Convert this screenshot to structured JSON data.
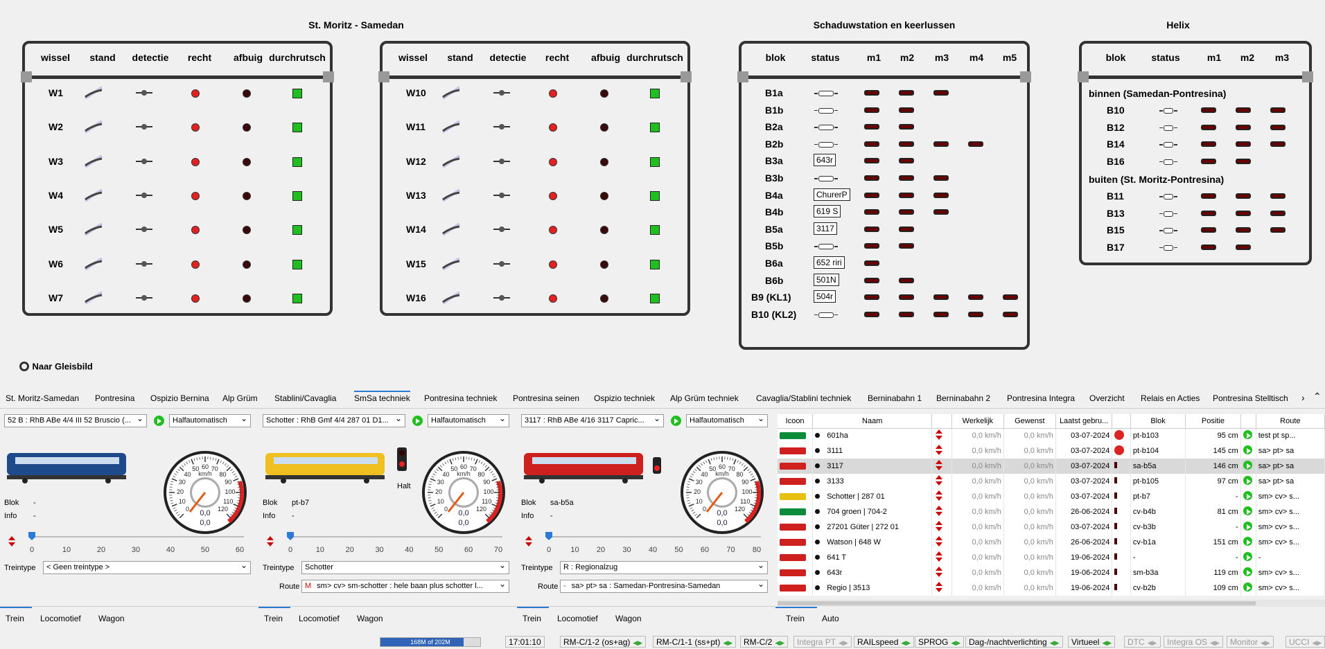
{
  "panels": {
    "stm": {
      "title": "St. Moritz - Samedan",
      "headers": [
        "wissel",
        "stand",
        "detectie",
        "recht",
        "afbuig",
        "durchrutsch"
      ],
      "rows": [
        "W1",
        "W2",
        "W3",
        "W4",
        "W5",
        "W6",
        "W7"
      ]
    },
    "pont": {
      "headers": [
        "wissel",
        "stand",
        "detectie",
        "recht",
        "afbuig",
        "durchrutsch"
      ],
      "rows": [
        "W10",
        "W11",
        "W12",
        "W13",
        "W14",
        "W15",
        "W16"
      ]
    },
    "schad": {
      "title": "Schaduwstation en keerlussen",
      "headers": [
        "blok",
        "status",
        "m1",
        "m2",
        "m3",
        "m4",
        "m5"
      ],
      "rows": [
        "B1a",
        "B1b",
        "B2a",
        "B2b",
        "B3a",
        "B3b",
        "B4a",
        "B4b",
        "B5a",
        "B5b",
        "B6a",
        "B6b",
        "B9 (KL1)",
        "B10 (KL2)"
      ],
      "labels": {
        "B3a": "643r",
        "B4a": "ChurerP",
        "B4b": "619 S",
        "B5a": "3117",
        "B6a": "652 riri",
        "B6b": "501N",
        "B9 (KL1)": "504r"
      }
    },
    "helix": {
      "title": "Helix",
      "headers": [
        "blok",
        "status",
        "m1",
        "m2",
        "m3"
      ],
      "group1": "binnen (Samedan-Pontresina)",
      "rows1": [
        "B10",
        "B12",
        "B14",
        "B16"
      ],
      "group2": "buiten (St. Moritz-Pontresina)",
      "rows2": [
        "B11",
        "B13",
        "B15",
        "B17"
      ]
    }
  },
  "naar_gleisbild": "Naar Gleisbild",
  "tabs": [
    "St. Moritz-Samedan",
    "Pontresina",
    "Ospizio Bernina",
    "Alp Grüm",
    "Stablini/Cavaglia",
    "SmSa techniek",
    "Pontresina techniek",
    "Pontresina seinen",
    "Ospizio techniek",
    "Alp Grüm techniek",
    "Cavaglia/Stablini techniek",
    "Berninabahn 1",
    "Berninabahn 2",
    "Pontresina Integra",
    "Overzicht",
    "Relais en Acties",
    "Pontresina Stelltisch"
  ],
  "throttles": [
    {
      "loco": "52 B : RhB ABe 4/4 III 52 Bruscio (...",
      "mode": "Halfautomatisch",
      "blok_label": "Blok",
      "blok": "-",
      "info_label": "Info",
      "info": "-",
      "speed1": "0,0",
      "speed2": "0,0",
      "unit": "km/h",
      "scale": [
        "0",
        "10",
        "20",
        "30",
        "40",
        "50",
        "60"
      ],
      "gauge": [
        "0",
        "10",
        "20",
        "30",
        "40",
        "50",
        "60",
        "70",
        "80",
        "90",
        "100",
        "110",
        "120"
      ],
      "treintype_label": "Treintype",
      "treintype": "< Geen treintype >",
      "tabs": [
        "Trein",
        "Locomotief",
        "Wagon"
      ]
    },
    {
      "loco": "Schotter : RhB Gmf 4/4 287 01 D1...",
      "mode": "Halfautomatisch",
      "halt": "Halt",
      "blok_label": "Blok",
      "blok": "pt-b7",
      "info_label": "Info",
      "info": "-",
      "speed1": "0,0",
      "speed2": "0,0",
      "unit": "km/h",
      "scale": [
        "0",
        "10",
        "20",
        "30",
        "40",
        "50",
        "60",
        "70"
      ],
      "gauge": [
        "0",
        "10",
        "20",
        "30",
        "40",
        "50",
        "60",
        "70",
        "80",
        "90",
        "100",
        "110",
        "120"
      ],
      "treintype_label": "Treintype",
      "treintype": "Schotter",
      "route_label": "Route",
      "route_prefix": "M",
      "route": "sm> cv> sm-schotter : hele baan plus schotter l...",
      "tabs": [
        "Trein",
        "Locomotief",
        "Wagon"
      ]
    },
    {
      "loco": "3117 : RhB ABe 4/16 3117 Capric...",
      "mode": "Halfautomatisch",
      "blok_label": "Blok",
      "blok": "sa-b5a",
      "info_label": "Info",
      "info": "-",
      "speed1": "0,0",
      "speed2": "0,0",
      "unit": "km/h",
      "scale": [
        "0",
        "10",
        "20",
        "30",
        "40",
        "50",
        "60",
        "70",
        "80"
      ],
      "gauge": [
        "0",
        "10",
        "20",
        "30",
        "40",
        "50",
        "60",
        "70",
        "80",
        "90",
        "100",
        "110",
        "120"
      ],
      "treintype_label": "Treintype",
      "treintype": "R : Regionalzug",
      "route_label": "Route",
      "route_prefix": "-",
      "route": "sa> pt> sa : Samedan-Pontresina-Samedan",
      "tabs": [
        "Trein",
        "Locomotief",
        "Wagon"
      ]
    }
  ],
  "table": {
    "headers": [
      "Icoon",
      "Naam",
      "",
      "Werkelijk",
      "Gewenst",
      "Laatst gebru...",
      "",
      "Blok",
      "Positie",
      "",
      "Route"
    ],
    "rows": [
      {
        "naam": "601ha",
        "werk": "0,0 km/h",
        "gew": "0,0 km/h",
        "datum": "03-07-2024",
        "blok": "pt-b103",
        "pos": "95 cm",
        "route": "test pt sp..."
      },
      {
        "naam": "3111",
        "werk": "0,0 km/h",
        "gew": "0,0 km/h",
        "datum": "03-07-2024",
        "blok": "pt-b104",
        "pos": "145 cm",
        "route": "sa> pt> sa"
      },
      {
        "naam": "3117",
        "werk": "0,0 km/h",
        "gew": "0,0 km/h",
        "datum": "03-07-2024",
        "blok": "sa-b5a",
        "pos": "146 cm",
        "route": "sa> pt> sa"
      },
      {
        "naam": "3133",
        "werk": "0,0 km/h",
        "gew": "0,0 km/h",
        "datum": "03-07-2024",
        "blok": "pt-b105",
        "pos": "97 cm",
        "route": "sa> pt> sa"
      },
      {
        "naam": "Schotter | 287 01",
        "werk": "0,0 km/h",
        "gew": "0,0 km/h",
        "datum": "03-07-2024",
        "blok": "pt-b7",
        "pos": "-",
        "route": "sm> cv> s..."
      },
      {
        "naam": "704 groen | 704-2",
        "werk": "0,0 km/h",
        "gew": "0,0 km/h",
        "datum": "26-06-2024",
        "blok": "cv-b4b",
        "pos": "81 cm",
        "route": "sm> cv> s..."
      },
      {
        "naam": "27201 Güter | 272 01",
        "werk": "0,0 km/h",
        "gew": "0,0 km/h",
        "datum": "03-07-2024",
        "blok": "cv-b3b",
        "pos": "-",
        "route": "sm> cv> s..."
      },
      {
        "naam": "Watson | 648 W",
        "werk": "0,0 km/h",
        "gew": "0,0 km/h",
        "datum": "26-06-2024",
        "blok": "cv-b1a",
        "pos": "151 cm",
        "route": "sm> cv> s..."
      },
      {
        "naam": "641 T",
        "werk": "0,0 km/h",
        "gew": "0,0 km/h",
        "datum": "19-06-2024",
        "blok": "-",
        "pos": "-",
        "route": "-"
      },
      {
        "naam": "643r",
        "werk": "0,0 km/h",
        "gew": "0,0 km/h",
        "datum": "19-06-2024",
        "blok": "sm-b3a",
        "pos": "119 cm",
        "route": "sm> cv> s..."
      },
      {
        "naam": "Regio | 3513",
        "werk": "0,0 km/h",
        "gew": "0,0 km/h",
        "datum": "19-06-2024",
        "blok": "cv-b2b",
        "pos": "109 cm",
        "route": "sm> cv> s..."
      }
    ],
    "tabs": [
      "Trein",
      "Auto"
    ]
  },
  "memory": "168M of 202M",
  "memory_used_fraction": 0.83,
  "clock": "17:01:10",
  "status_items": [
    "RM-C/1-2 (os+ag)",
    "RM-C/1-1 (ss+pt)",
    "RM-C/2",
    "Integra PT",
    "RAILspeed",
    "SPROG",
    "Dag-/nachtverlichting",
    "Virtueel",
    "DTC",
    "Integra OS",
    "Monitor",
    "UCCI"
  ]
}
